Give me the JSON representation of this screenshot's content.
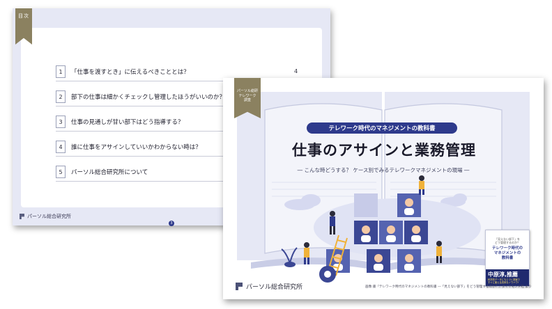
{
  "toc": {
    "ribbon_label": "目次",
    "items": [
      {
        "num": "1",
        "text": "「仕事を渡すとき」に伝えるべきこととは？",
        "page": "4"
      },
      {
        "num": "2",
        "text": "部下の仕事は細かくチェックし管理したほうがいいのか？",
        "page": ""
      },
      {
        "num": "3",
        "text": "仕事の見通しが甘い部下はどう指導する？",
        "page": ""
      },
      {
        "num": "4",
        "text": "誰に仕事をアサインしていいかわからない時は？",
        "page": ""
      },
      {
        "num": "5",
        "text": "パーソル総合研究所について",
        "page": ""
      }
    ],
    "logo_text": "パーソル総合研究所",
    "page_number": "3"
  },
  "cover": {
    "ribbon_label": "パーソル総研\nテレワーク\n調査",
    "series_pill": "テレワーク時代のマネジメントの教科書",
    "title": "仕事のアサインと業務管理",
    "subtitle": "― こんな時どうする？ ケース別でみるテレワークマネジメントの現場 ―",
    "logo_text": "パーソル総合研究所",
    "credit": "画像:書『テレワーク時代のマネジメントの教科書 ―「見えない部下」をどう管理するのか？』ダイヤモンド社 より",
    "book": {
      "small_text": "「見えない部下」を\nどう管理するのか？",
      "title": "テレワーク時代の\nマネジメントの\n教科書",
      "author": "中原淳,推薦",
      "band_text": "科学的データにもとづく提案で\nすぐに使える具体なノウハウ!"
    }
  },
  "colors": {
    "navy": "#2e3a8c",
    "ribbon": "#8b8160",
    "lavender": "#e6e8f5"
  }
}
